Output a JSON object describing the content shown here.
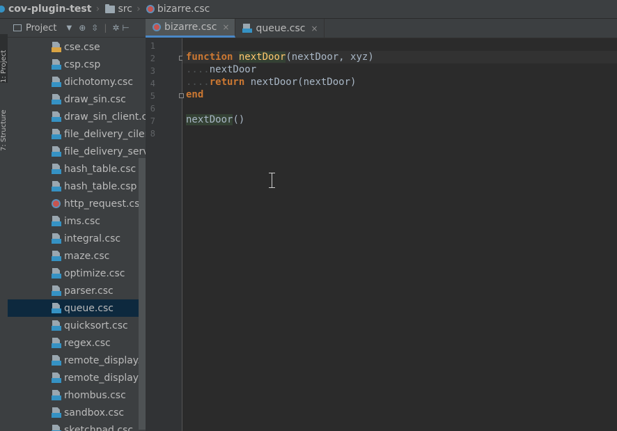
{
  "breadcrumb": {
    "project": "cov-plugin-test",
    "folder": "src",
    "file": "bizarre.csc"
  },
  "tool_window_strip": {
    "project_tab": "1: Project",
    "structure_tab": "7: Structure"
  },
  "project_panel": {
    "title": "Project",
    "toolbar_icons": [
      "dropdown-icon",
      "target-icon",
      "collapse-icon",
      "settings-icon",
      "hide-icon"
    ],
    "files": [
      {
        "name": "cse.cse",
        "icon": "cse-file-icon",
        "selected": false
      },
      {
        "name": "csp.csp",
        "icon": "csc-file-icon",
        "selected": false
      },
      {
        "name": "dichotomy.csc",
        "icon": "csc-file-icon",
        "selected": false
      },
      {
        "name": "draw_sin.csc",
        "icon": "csc-file-icon",
        "selected": false
      },
      {
        "name": "draw_sin_client.c",
        "icon": "csc-file-icon",
        "selected": false
      },
      {
        "name": "file_delivery_cilen",
        "icon": "csc-file-icon",
        "selected": false
      },
      {
        "name": "file_delivery_serv",
        "icon": "csc-file-icon",
        "selected": false
      },
      {
        "name": "hash_table.csc",
        "icon": "csc-file-icon",
        "selected": false
      },
      {
        "name": "hash_table.csp",
        "icon": "csc-file-icon",
        "selected": false
      },
      {
        "name": "http_request.csc",
        "icon": "globe-file-icon",
        "selected": false
      },
      {
        "name": "ims.csc",
        "icon": "csc-file-icon",
        "selected": false
      },
      {
        "name": "integral.csc",
        "icon": "csc-file-icon",
        "selected": false
      },
      {
        "name": "maze.csc",
        "icon": "csc-file-icon",
        "selected": false
      },
      {
        "name": "optimize.csc",
        "icon": "csc-file-icon",
        "selected": false
      },
      {
        "name": "parser.csc",
        "icon": "csc-file-icon",
        "selected": false
      },
      {
        "name": "queue.csc",
        "icon": "csc-file-icon",
        "selected": true
      },
      {
        "name": "quicksort.csc",
        "icon": "csc-file-icon",
        "selected": false
      },
      {
        "name": "regex.csc",
        "icon": "csc-file-icon",
        "selected": false
      },
      {
        "name": "remote_display.c",
        "icon": "csc-file-icon",
        "selected": false
      },
      {
        "name": "remote_display_s",
        "icon": "csc-file-icon",
        "selected": false
      },
      {
        "name": "rhombus.csc",
        "icon": "csc-file-icon",
        "selected": false
      },
      {
        "name": "sandbox.csc",
        "icon": "csc-file-icon",
        "selected": false
      },
      {
        "name": "sketchpad.csc",
        "icon": "csc-file-icon",
        "selected": false
      }
    ]
  },
  "editor_tabs": [
    {
      "label": "bizarre.csc",
      "icon": "globe-file-icon",
      "active": true,
      "close": "×"
    },
    {
      "label": "queue.csc",
      "icon": "csc-file-icon",
      "active": false,
      "close": "×"
    }
  ],
  "editor": {
    "line_numbers": [
      "1",
      "2",
      "3",
      "4",
      "5",
      "6",
      "7",
      "8"
    ],
    "lines": [
      "",
      "function nextDoor(nextDoor, xyz)",
      "    nextDoor",
      "    return nextDoor(nextDoor)",
      "end",
      "",
      "nextDoor()",
      ""
    ],
    "current_line": 2
  },
  "colors": {
    "keyword": "#cc7832",
    "function_name": "#ffc66d",
    "identifier": "#a9b7c6",
    "usage_highlight": "#344134",
    "selection": "#0d293e",
    "accent": "#4a88c7"
  }
}
